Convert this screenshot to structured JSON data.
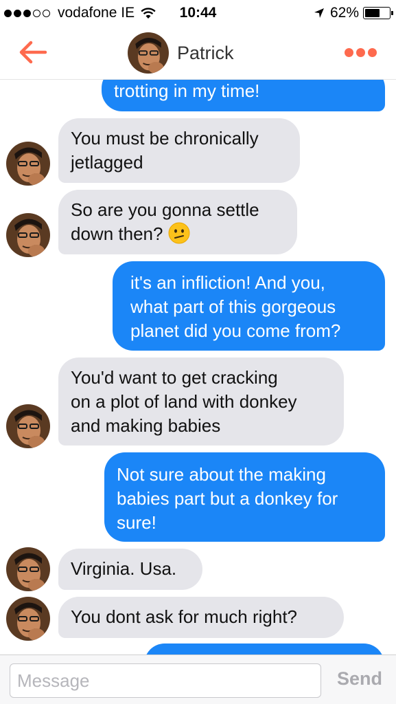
{
  "status_bar": {
    "carrier": "vodafone IE",
    "signal_bars_filled": 3,
    "signal_bars_total": 5,
    "time": "10:44",
    "battery_percent": "62%",
    "battery_level": 0.62,
    "icons": [
      "wifi-icon",
      "location-arrow-icon",
      "battery-icon"
    ]
  },
  "header": {
    "contact_name": "Patrick",
    "icons": [
      "back-arrow-icon",
      "more-dots-icon"
    ],
    "accent_color": "#fe6a4e"
  },
  "colors": {
    "incoming_bubble": "#e5e5ea",
    "outgoing_bubble": "#1b86f7"
  },
  "messages": [
    {
      "direction": "outgoing",
      "lines": [
        "trotting in my time!"
      ]
    },
    {
      "direction": "incoming",
      "lines": [
        "You must be chronically",
        "jetlagged"
      ]
    },
    {
      "direction": "incoming",
      "lines": [
        "So are you gonna settle",
        "down then?"
      ],
      "emoji": "confused-face-emoji"
    },
    {
      "direction": "outgoing",
      "lines": [
        "it's an infliction! And you,",
        "what part of this gorgeous",
        "planet did you come from?"
      ]
    },
    {
      "direction": "incoming",
      "lines": [
        "You'd want to get cracking",
        "on a plot of land with donkey",
        "and making babies"
      ]
    },
    {
      "direction": "outgoing",
      "lines": [
        "Not sure about the making",
        "babies part but a donkey for",
        "sure!"
      ]
    },
    {
      "direction": "incoming",
      "lines": [
        "Virginia. Usa."
      ]
    },
    {
      "direction": "incoming",
      "lines": [
        "You dont ask for much right?"
      ]
    }
  ],
  "composer": {
    "placeholder": "Message",
    "value": "",
    "send_label": "Send"
  }
}
